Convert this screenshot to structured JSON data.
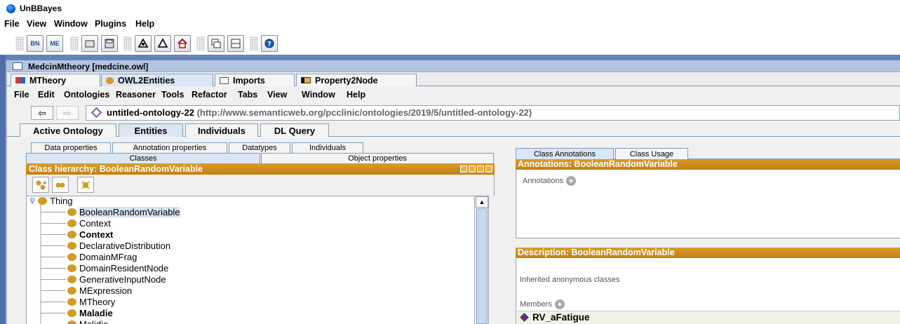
{
  "app": {
    "title": "UnBBayes",
    "menu": [
      "File",
      "View",
      "Window",
      "Plugins",
      "Help"
    ],
    "toolbar_buttons": [
      {
        "icon": "bn-icon",
        "label": "BN"
      },
      {
        "icon": "mebn-icon",
        "label": "ME"
      },
      {
        "icon": "open-icon",
        "label": ""
      },
      {
        "icon": "save-icon",
        "label": ""
      },
      {
        "icon": "learning-icon",
        "label": ""
      },
      {
        "icon": "tan-icon",
        "label": ""
      },
      {
        "icon": "home-icon",
        "label": ""
      },
      {
        "icon": "cascade-icon",
        "label": ""
      },
      {
        "icon": "tile-icon",
        "label": ""
      },
      {
        "icon": "help-icon",
        "label": ""
      }
    ]
  },
  "internal_frame": {
    "title": "MedcinMtheory [medcine.owl]",
    "plugin_tabs": [
      {
        "label": "MTheory",
        "icon": "mtheory-icon"
      },
      {
        "label": "OWL2Entities",
        "icon": "owl-dot-icon"
      },
      {
        "label": "Imports",
        "icon": "imports-icon"
      },
      {
        "label": "Property2Node",
        "icon": "property-node-icon"
      }
    ]
  },
  "protege": {
    "menu": [
      "File",
      "Edit",
      "Ontologies",
      "Reasoner",
      "Tools",
      "Refactor",
      "Tabs",
      "View",
      "Window",
      "Help"
    ],
    "nav": {
      "back": "⇦",
      "forward": "⇨"
    },
    "ontology": {
      "name": "untitled-ontology-22",
      "iri": "(http://www.semanticweb.org/pcclinic/ontologies/2019/5/untitled-ontology-22)"
    },
    "main_tabs": [
      "Active Ontology",
      "Entities",
      "Individuals",
      "DL Query"
    ],
    "entity_tabs_row1": [
      "Data properties",
      "Annotation properties",
      "Datatypes",
      "Individuals"
    ],
    "entity_tabs_row2": [
      "Classes",
      "Object properties"
    ],
    "class_hierarchy": {
      "title": "Class hierarchy: BooleanRandomVariable",
      "root": "Thing",
      "items": [
        {
          "label": "BooleanRandomVariable",
          "selected": true,
          "bold": false
        },
        {
          "label": "Context",
          "selected": false,
          "bold": false
        },
        {
          "label": "Context",
          "selected": false,
          "bold": true
        },
        {
          "label": "DeclarativeDistribution",
          "selected": false,
          "bold": false
        },
        {
          "label": "DomainMFrag",
          "selected": false,
          "bold": false
        },
        {
          "label": "DomainResidentNode",
          "selected": false,
          "bold": false
        },
        {
          "label": "GenerativeInputNode",
          "selected": false,
          "bold": false
        },
        {
          "label": "MExpression",
          "selected": false,
          "bold": false
        },
        {
          "label": "MTheory",
          "selected": false,
          "bold": false
        },
        {
          "label": "Maladie",
          "selected": false,
          "bold": true
        },
        {
          "label": "Malidie",
          "selected": false,
          "bold": false
        }
      ]
    },
    "right_tabs": [
      "Class Annotations",
      "Class Usage"
    ],
    "annotations": {
      "title": "Annotations: BooleanRandomVariable",
      "label": "Annotations"
    },
    "description": {
      "title": "Description: BooleanRandomVariable",
      "inherited_label": "Inherited anonymous classes",
      "members_label": "Members",
      "members": [
        "RV_aFatigue"
      ]
    }
  },
  "colors": {
    "header_orange": "#c9861a",
    "tab_active": "#dbe6f4",
    "class_dot": "#d49a22",
    "selection": "#d6e2f2"
  }
}
